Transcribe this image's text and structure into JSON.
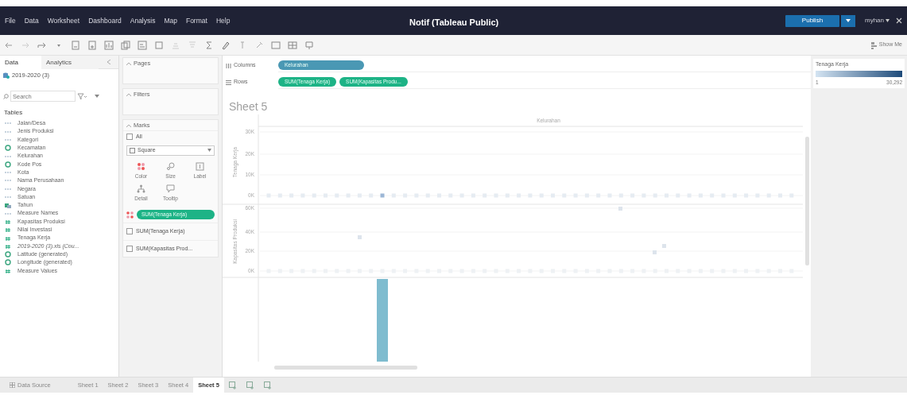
{
  "menu_bar": {
    "items": [
      "File",
      "Data",
      "Worksheet",
      "Dashboard",
      "Analysis",
      "Map",
      "Format",
      "Help"
    ],
    "title": "Notif (Tableau Public)",
    "publish": "Publish",
    "user": "myhan"
  },
  "toolbar": {
    "show_me": "Show Me"
  },
  "data_pane": {
    "tabs": [
      {
        "label": "Data",
        "selected": true
      },
      {
        "label": "Analytics",
        "selected": false
      }
    ],
    "source": "2019-2020 (3)",
    "search": {
      "placeholder": "Search"
    },
    "tables_heading": "Tables",
    "fields": [
      {
        "name": "Jalan/Desa",
        "kind": "string"
      },
      {
        "name": "Jenis Produksi",
        "kind": "string"
      },
      {
        "name": "Kategori",
        "kind": "string"
      },
      {
        "name": "Kecamatan",
        "kind": "geo"
      },
      {
        "name": "Kelurahan",
        "kind": "string"
      },
      {
        "name": "Kode Pos",
        "kind": "geo"
      },
      {
        "name": "Kota",
        "kind": "string"
      },
      {
        "name": "Nama Perusahaan",
        "kind": "string"
      },
      {
        "name": "Negara",
        "kind": "string"
      },
      {
        "name": "Satuan",
        "kind": "string"
      },
      {
        "name": "Tahun",
        "kind": "date"
      },
      {
        "name": "Measure Names",
        "kind": "string"
      },
      {
        "name": "Kapasitas Produksi",
        "kind": "number"
      },
      {
        "name": "Nilai Investasi",
        "kind": "number"
      },
      {
        "name": "Tenaga Kerja",
        "kind": "number"
      },
      {
        "name": "2019-2020 (3).xls (Cou...",
        "kind": "count"
      },
      {
        "name": "Latitude (generated)",
        "kind": "geo"
      },
      {
        "name": "Longitude (generated)",
        "kind": "geo"
      },
      {
        "name": "Measure Values",
        "kind": "number"
      }
    ]
  },
  "cards": {
    "pages": "Pages",
    "filters": "Filters",
    "marks": {
      "heading": "Marks",
      "all": {
        "label": "All",
        "checked": false
      },
      "mark_type": "Square",
      "buttons": [
        {
          "label": "Color",
          "kind": "color"
        },
        {
          "label": "Size",
          "kind": "size"
        },
        {
          "label": "Label",
          "kind": "label"
        },
        {
          "label": "Detail",
          "kind": "detail"
        },
        {
          "label": "Tooltip",
          "kind": "tooltip"
        }
      ],
      "color_pill": "SUM(Tenaga Kerja)",
      "measures": [
        {
          "label": "SUM(Tenaga Kerja)",
          "checked": false
        },
        {
          "label": "SUM(Kapasitas Prod...",
          "checked": false
        }
      ]
    }
  },
  "shelves": [
    {
      "label": "Columns",
      "kind": "columns",
      "pills": [
        {
          "label": "Kelurahan",
          "kind": "dimension"
        }
      ]
    },
    {
      "label": "Rows",
      "kind": "rows",
      "pills": [
        {
          "label": "SUM(Tenaga Kerja)",
          "kind": "measure"
        },
        {
          "label": "SUM(Kapasitas Produ...",
          "kind": "measure"
        }
      ]
    }
  ],
  "view": {
    "title": "Sheet 5",
    "column_header": "Kelurahan",
    "panes": [
      {
        "axis_title": "Tenaga Kerja",
        "ticks": [
          "30K",
          "20K",
          "10K",
          "0K"
        ]
      },
      {
        "axis_title": "Kapasitas Produksi",
        "ticks": [
          "60K",
          "40K",
          "20K",
          "0K"
        ]
      }
    ]
  },
  "legend": {
    "title": "Tenaga Kerja",
    "min": "1",
    "max": "30,292"
  },
  "sheet_tabs": {
    "data_source": "Data Source",
    "sheets": [
      {
        "label": "Sheet 1",
        "selected": false
      },
      {
        "label": "Sheet 2",
        "selected": false
      },
      {
        "label": "Sheet 3",
        "selected": false
      },
      {
        "label": "Sheet 4",
        "selected": false
      },
      {
        "label": "Sheet 5",
        "selected": true
      }
    ]
  }
}
